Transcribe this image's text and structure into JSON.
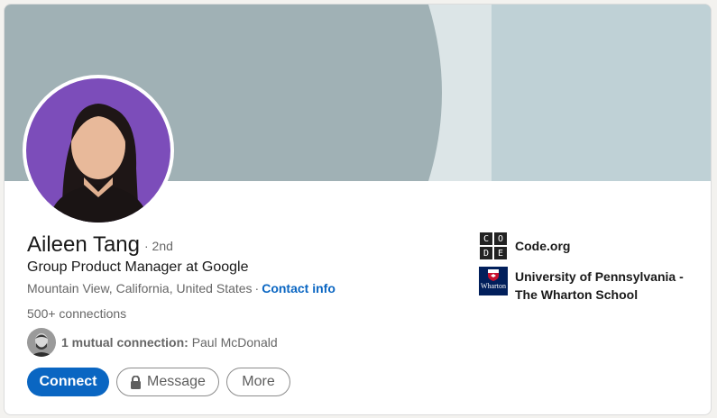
{
  "profile": {
    "name": "Aileen Tang",
    "degree": "· 2nd",
    "headline": "Group Product Manager at Google",
    "location": "Mountain View, California, United States",
    "location_separator": "·",
    "contact_label": "Contact info",
    "connections": "500+ connections"
  },
  "mutual": {
    "label": "1 mutual connection:",
    "name": "Paul McDonald"
  },
  "actions": {
    "connect_label": "Connect",
    "message_label": "Message",
    "more_label": "More"
  },
  "organizations": [
    {
      "name": "Code.org",
      "logo_letters": [
        "C",
        "O",
        "D",
        "E"
      ],
      "logo_icon": "code-org-logo"
    },
    {
      "name": "University of Pennsylvania - The Wharton School",
      "logo_text": "Wharton",
      "logo_icon": "wharton-logo"
    }
  ],
  "colors": {
    "accent": "#0a66c2",
    "banner_dark": "#a0b1b5",
    "banner_light": "#dce5e7",
    "banner_right": "#bfd1d6",
    "avatar_bg": "#7c4dba"
  }
}
